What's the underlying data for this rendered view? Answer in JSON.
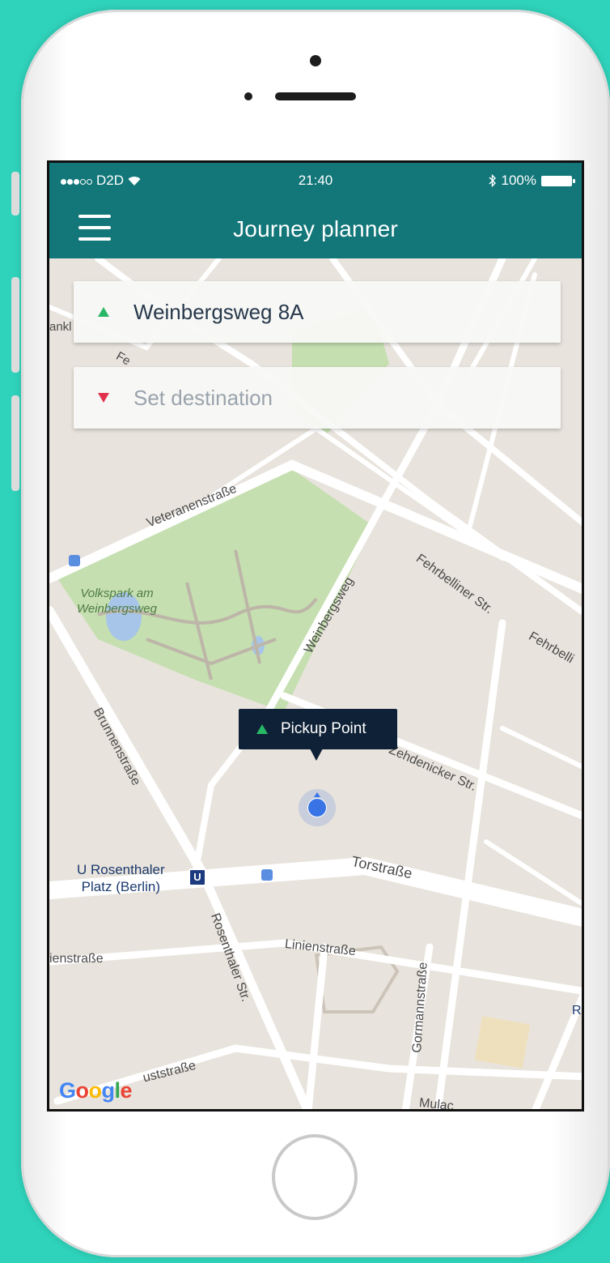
{
  "status_bar": {
    "carrier": "D2D",
    "time": "21:40",
    "battery": "100%",
    "wifi_icon": "wifi-icon",
    "bluetooth_icon": "bluetooth-icon"
  },
  "app_bar": {
    "title": "Journey planner",
    "menu_icon": "hamburger-menu-icon"
  },
  "search": {
    "origin": "Weinbergsweg 8A",
    "destination_placeholder": "Set destination"
  },
  "pickup": {
    "label": "Pickup Point"
  },
  "map": {
    "streets": {
      "veteranen": "Veteranenstraße",
      "fehrbelliner": "Fehrbelliner Str.",
      "fehrbelliner_cut": "Fehrbelli",
      "weinbergsweg": "Weinbergsweg",
      "brunnen": "Brunnenstraße",
      "zehdenicker": "Zehdenicker Str.",
      "tor": "Torstraße",
      "rosenthaler": "Rosenthaler Str.",
      "linien": "Linienstraße",
      "linien_cut": "ienstraße",
      "gormann": "Gormannstraße",
      "auguststrasse_cut": "uststraße",
      "mulack_cut": "Mulac",
      "left_cut": "ankl",
      "fe_cut": "Fe",
      "right_cut": "R"
    },
    "park": "Volkspark am Weinbergsweg",
    "park_line1": "Volkspark am",
    "park_line2": "Weinbergsweg",
    "transit_line1": "U Rosenthaler",
    "transit_line2": "Platz (Berlin)",
    "ubahn_badge": "U",
    "google": {
      "g1": "G",
      "o1": "o",
      "o2": "o",
      "g2": "g",
      "l": "l",
      "e": "e"
    }
  },
  "colors": {
    "header": "#13777a",
    "background": "#2fd3bb",
    "origin_marker": "#27b866",
    "destination_marker": "#e1324b",
    "pickup_tooltip": "#0e2136",
    "location_dot": "#3874e6"
  }
}
